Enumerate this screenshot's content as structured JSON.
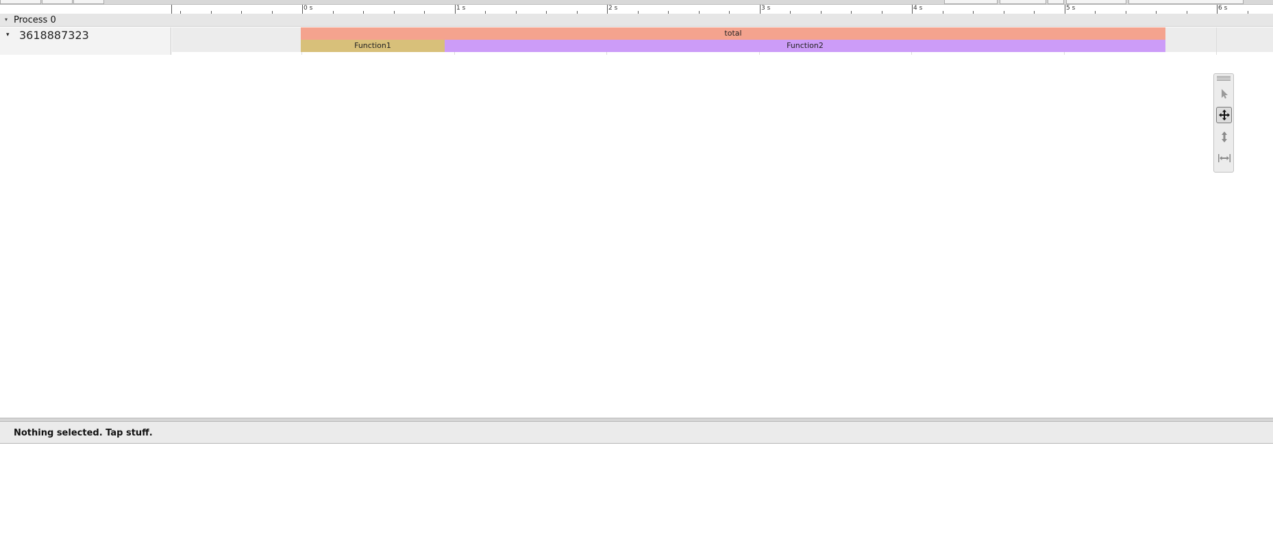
{
  "ruler": {
    "labels": [
      "0 s",
      "1 s",
      "2 s",
      "3 s",
      "4 s",
      "5 s",
      "6 s"
    ]
  },
  "process": {
    "title": "Process 0"
  },
  "thread": {
    "title": "3618887323"
  },
  "slices": {
    "total": "total",
    "function1": "Function1",
    "function2": "Function2"
  },
  "palette": {
    "tools": [
      "select-tool",
      "pan-tool",
      "zoom-tool",
      "timing-tool"
    ],
    "active_tool": "pan-tool"
  },
  "analysis": {
    "message": "Nothing selected. Tap stuff."
  },
  "colors": {
    "total": "#f4a38e",
    "function1": "#d8c07a",
    "function2": "#cc9cf8"
  }
}
